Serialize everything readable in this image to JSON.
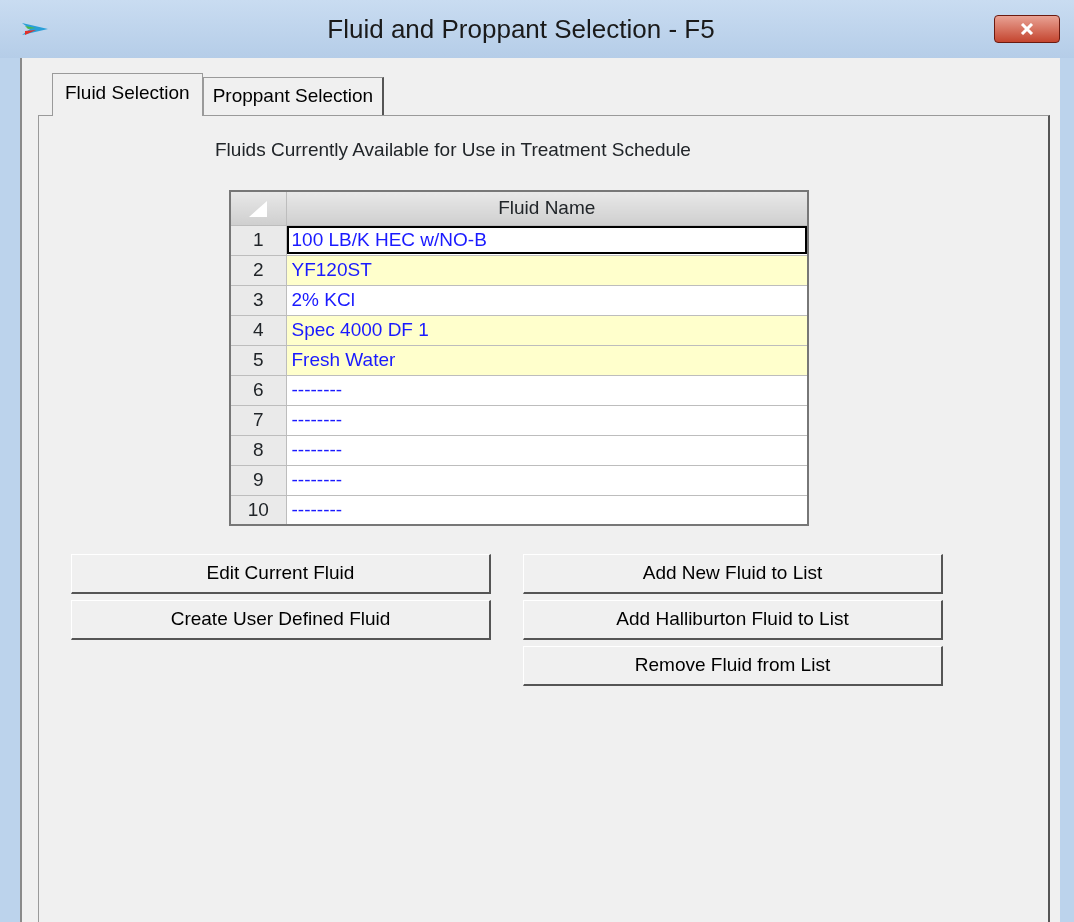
{
  "window": {
    "title": "Fluid and Proppant Selection - F5"
  },
  "tabs": [
    {
      "label": "Fluid Selection",
      "selected": true
    },
    {
      "label": "Proppant Selection",
      "selected": false
    }
  ],
  "caption": "Fluids Currently Available  for Use in Treatment Schedule",
  "table": {
    "columns": [
      "Fluid Name"
    ],
    "rows": [
      {
        "number": "1",
        "name": "100 LB/K HEC w/NO-B",
        "highlighted": false,
        "selected": true
      },
      {
        "number": "2",
        "name": "YF120ST",
        "highlighted": true,
        "selected": false
      },
      {
        "number": "3",
        "name": "2% KCl",
        "highlighted": false,
        "selected": false
      },
      {
        "number": "4",
        "name": "Spec 4000 DF 1",
        "highlighted": true,
        "selected": false
      },
      {
        "number": "5",
        "name": "Fresh Water",
        "highlighted": true,
        "selected": false
      },
      {
        "number": "6",
        "name": "--------",
        "highlighted": false,
        "selected": false
      },
      {
        "number": "7",
        "name": "--------",
        "highlighted": false,
        "selected": false
      },
      {
        "number": "8",
        "name": "--------",
        "highlighted": false,
        "selected": false
      },
      {
        "number": "9",
        "name": "--------",
        "highlighted": false,
        "selected": false
      },
      {
        "number": "10",
        "name": "--------",
        "highlighted": false,
        "selected": false
      }
    ]
  },
  "left_buttons": [
    "Edit Current Fluid",
    "Create User Defined Fluid"
  ],
  "right_buttons": [
    "Add New Fluid to List",
    "Add Halliburton Fluid to List",
    "Remove Fluid from List"
  ]
}
